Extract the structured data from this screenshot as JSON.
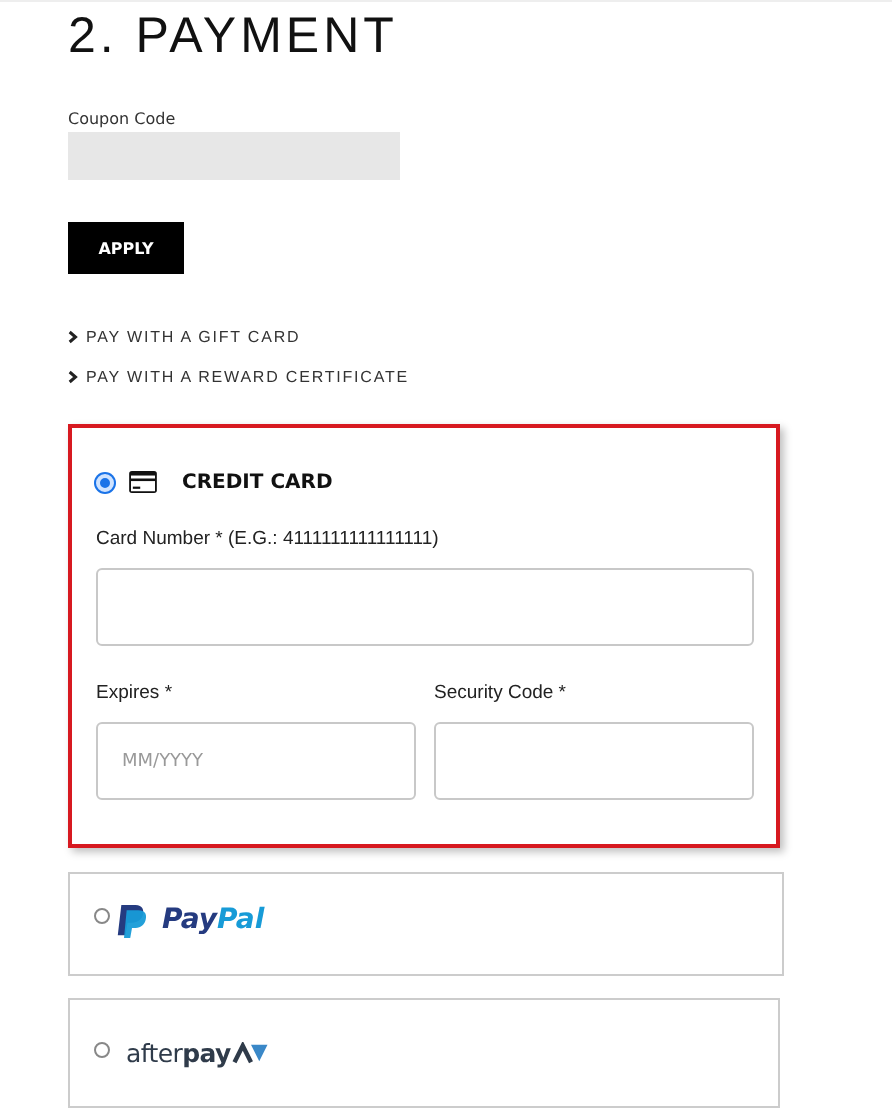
{
  "heading": "2. PAYMENT",
  "coupon": {
    "label": "Coupon Code",
    "button": "APPLY"
  },
  "links": [
    {
      "label": "PAY WITH A GIFT CARD"
    },
    {
      "label": "PAY WITH A REWARD CERTIFICATE"
    }
  ],
  "methods": [
    {
      "kind": "card",
      "selected": true,
      "label": "CREDIT CARD",
      "card_number_label": "Card Number * (E.G.: 4111111111111111)",
      "expires_label": "Expires *",
      "expires_placeholder": "MM/YYYY",
      "security_label": "Security Code *"
    },
    {
      "kind": "paypal",
      "selected": false,
      "logo_parts": [
        "Pay",
        "Pal"
      ]
    },
    {
      "kind": "afterpay",
      "selected": false,
      "logo": "after**pay**"
    }
  ]
}
